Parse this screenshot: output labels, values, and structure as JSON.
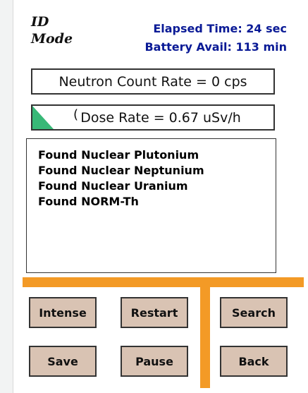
{
  "header": {
    "mode_line1": "ID",
    "mode_line2": "Mode",
    "elapsed": "Elapsed Time: 24 sec",
    "battery": "Battery Avail: 113 min"
  },
  "neutron": {
    "text": "Neutron Count Rate = 0 cps"
  },
  "dose": {
    "arc": "(",
    "text": "Dose Rate = 0.67 uSv/h",
    "gauge_color": "#38b877"
  },
  "results": [
    "Found Nuclear Plutonium",
    "Found Nuclear Neptunium",
    "Found Nuclear Uranium",
    "Found NORM-Th"
  ],
  "buttons": {
    "intense": "Intense",
    "restart": "Restart",
    "search": "Search",
    "save": "Save",
    "pause": "Pause",
    "back": "Back"
  },
  "colors": {
    "accent_orange": "#f39a26",
    "button_bg": "#d9c3b3",
    "status_text": "#0a1a96"
  }
}
